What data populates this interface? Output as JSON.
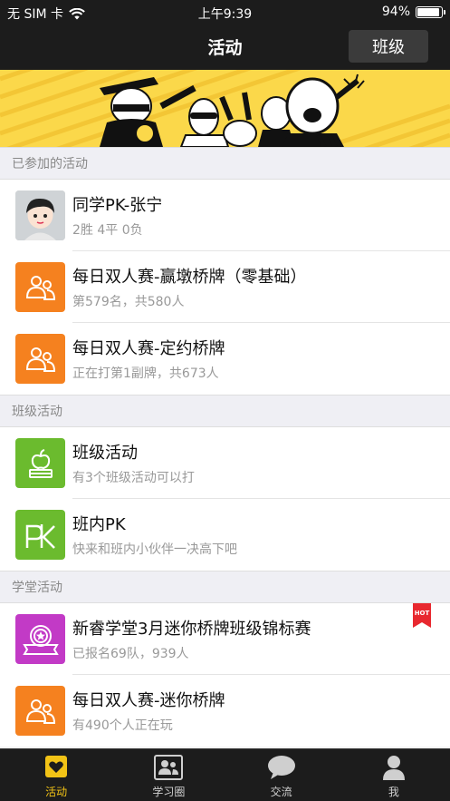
{
  "status_bar": {
    "carrier": "无 SIM 卡",
    "time": "上午9:39",
    "battery_text": "94%",
    "battery_level": 0.94
  },
  "nav": {
    "title": "活动",
    "class_button": "班级"
  },
  "sections": [
    {
      "header": "已参加的活动",
      "rows": [
        {
          "title": "同学PK-张宁",
          "subtitle": "2胜 4平 0负",
          "icon": "avatar-boy-icon"
        },
        {
          "title": "每日双人赛-赢墩桥牌（零基础）",
          "subtitle": "第579名，共580人",
          "icon": "two-people-icon"
        },
        {
          "title": "每日双人赛-定约桥牌",
          "subtitle": "正在打第1副牌，共673人",
          "icon": "two-people-icon"
        }
      ]
    },
    {
      "header": "班级活动",
      "rows": [
        {
          "title": "班级活动",
          "subtitle": "有3个班级活动可以打",
          "icon": "apple-book-icon"
        },
        {
          "title": "班内PK",
          "subtitle": "快来和班内小伙伴一决高下吧",
          "icon": "pk-icon"
        }
      ]
    },
    {
      "header": "学堂活动",
      "rows": [
        {
          "title": "新睿学堂3月迷你桥牌班级锦标赛",
          "subtitle": "已报名69队，939人",
          "icon": "medal-ribbon-icon",
          "badge": "HOT"
        },
        {
          "title": "每日双人赛-迷你桥牌",
          "subtitle": "有490个人正在玩",
          "icon": "two-people-icon"
        }
      ]
    }
  ],
  "tabs": [
    {
      "label": "活动",
      "icon": "heart-icon",
      "active": true
    },
    {
      "label": "学习圈",
      "icon": "people-card-icon",
      "active": false
    },
    {
      "label": "交流",
      "icon": "chat-bubble-icon",
      "active": false
    },
    {
      "label": "我",
      "icon": "person-icon",
      "active": false
    }
  ],
  "colors": {
    "nav_bg": "#1c1c1c",
    "banner_bg": "#fbd84a",
    "orange_icon": "#f5811f",
    "green_icon": "#6bbb2e",
    "purple_icon": "#c23ac6",
    "tab_active": "#f2c316",
    "hot_red": "#e8282f"
  }
}
